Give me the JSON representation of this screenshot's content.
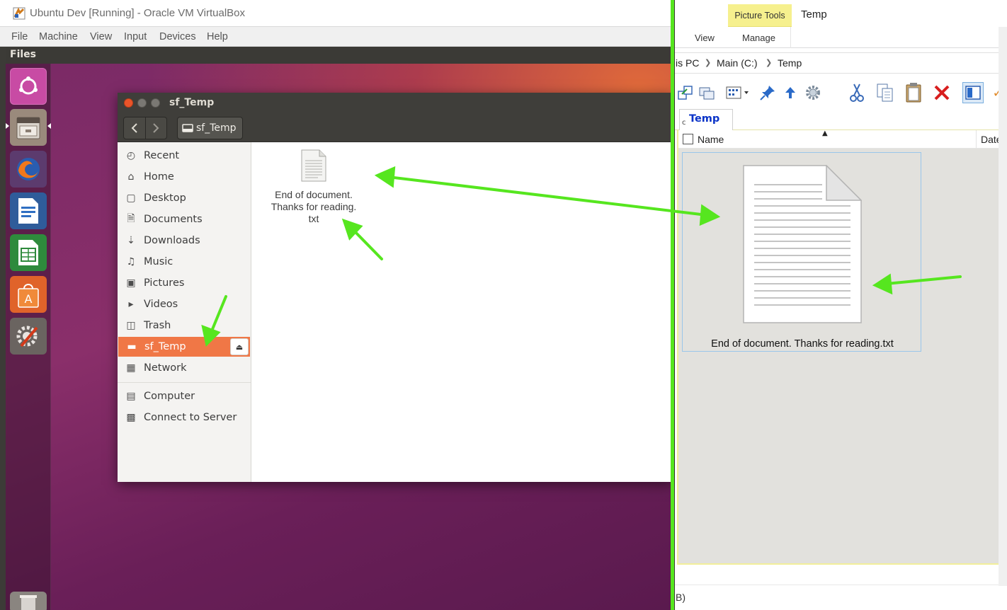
{
  "virtualbox": {
    "title": "Ubuntu Dev [Running] - Oracle VM VirtualBox",
    "menu": [
      "File",
      "Machine",
      "View",
      "Input",
      "Devices",
      "Help"
    ]
  },
  "ubuntu": {
    "topbar_title": "Files",
    "launcher": [
      "ubuntu-dash-icon",
      "files-icon",
      "firefox-icon",
      "writer-icon",
      "calc-icon",
      "software-center-icon",
      "system-settings-icon",
      "trash-icon"
    ]
  },
  "nautilus": {
    "window_title": "sf_Temp",
    "path_button": "sf_Temp",
    "sidebar": [
      {
        "label": "Recent",
        "icon": "clock-icon"
      },
      {
        "label": "Home",
        "icon": "home-icon"
      },
      {
        "label": "Desktop",
        "icon": "folder-icon"
      },
      {
        "label": "Documents",
        "icon": "document-icon"
      },
      {
        "label": "Downloads",
        "icon": "download-icon"
      },
      {
        "label": "Music",
        "icon": "music-icon"
      },
      {
        "label": "Pictures",
        "icon": "camera-icon"
      },
      {
        "label": "Videos",
        "icon": "video-icon"
      },
      {
        "label": "Trash",
        "icon": "trash-icon"
      },
      {
        "label": "sf_Temp",
        "icon": "drive-icon",
        "active": true
      },
      {
        "label": "Network",
        "icon": "network-icon"
      },
      {
        "label": "Computer",
        "icon": "computer-icon"
      },
      {
        "label": "Connect to Server",
        "icon": "server-icon"
      }
    ],
    "file": {
      "line1": "End of document.",
      "line2": "Thanks for reading.",
      "line3": "txt"
    }
  },
  "explorer": {
    "contextual_tab": "Picture Tools",
    "window_title": "Temp",
    "ribbon_tabs": [
      "View",
      "Manage"
    ],
    "breadcrumbs": [
      "is PC",
      "Main (C:)",
      "Temp"
    ],
    "tab_label": "Temp",
    "tab_prefix": "c",
    "columns": {
      "name": "Name",
      "date": "Date"
    },
    "file_name": "End of document.  Thanks for reading.txt",
    "status_text": "B)"
  },
  "colors": {
    "annotation_arrow": "#56e61f",
    "nautilus_active": "#f07746",
    "picture_tools": "#f6f08e",
    "explorer_selection_border": "#9ac6ea"
  }
}
